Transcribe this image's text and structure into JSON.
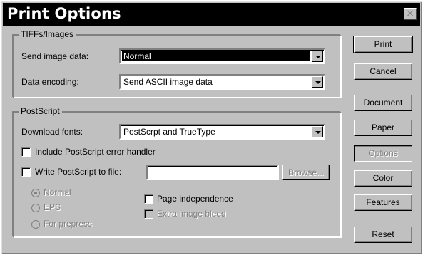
{
  "window": {
    "title": "Print Options",
    "close_symbol": "×"
  },
  "tiffs_group": {
    "legend": "TIFFs/Images",
    "send_image_data": {
      "label": "Send image data:",
      "value": "Normal"
    },
    "data_encoding": {
      "label": "Data encoding:",
      "value": "Send ASCII image data"
    }
  },
  "postscript_group": {
    "legend": "PostScript",
    "download_fonts": {
      "label": "Download fonts:",
      "value": "PostScrpt and TrueType"
    },
    "include_error_handler": {
      "label": "Include PostScript error handler",
      "checked": false
    },
    "write_to_file": {
      "label": "Write PostScript to file:",
      "checked": false,
      "value": ""
    },
    "browse_label": "Browse...",
    "radios": [
      {
        "label": "Normal",
        "checked": true
      },
      {
        "label": "EPS",
        "checked": false
      },
      {
        "label": "For prepress",
        "checked": false
      }
    ],
    "page_independence": {
      "label": "Page independence",
      "checked": false
    },
    "extra_image_bleed": {
      "label": "Extra image bleed",
      "checked": false
    }
  },
  "buttons": {
    "print": "Print",
    "cancel": "Cancel",
    "document": "Document",
    "paper": "Paper",
    "options": "Options",
    "color": "Color",
    "features": "Features",
    "reset": "Reset"
  }
}
